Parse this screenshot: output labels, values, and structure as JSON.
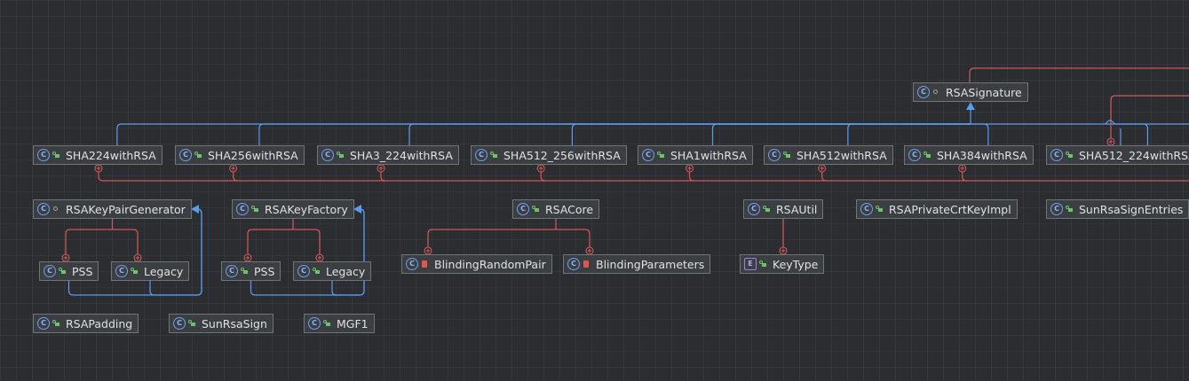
{
  "colors": {
    "background": "#2b2d30",
    "node_fill": "#3c3f41",
    "node_border": "#6f737a",
    "inheritance_edge": "#5b9bf0",
    "inner_class_edge": "#d05a5a",
    "class_icon": "#6e9ef7",
    "public_icon": "#6cc46a",
    "private_icon": "#e0564f"
  },
  "nodes": [
    {
      "id": "RSASignature",
      "label": "RSASignature",
      "kind": "class",
      "access": "package",
      "icon": "class-icon"
    },
    {
      "id": "SHA224withRSA",
      "label": "SHA224withRSA",
      "kind": "class",
      "access": "public",
      "icon": "class-icon"
    },
    {
      "id": "SHA256withRSA",
      "label": "SHA256withRSA",
      "kind": "class",
      "access": "public",
      "icon": "class-icon"
    },
    {
      "id": "SHA3_224withRSA",
      "label": "SHA3_224withRSA",
      "kind": "class",
      "access": "public",
      "icon": "class-icon"
    },
    {
      "id": "SHA512_256withRSA",
      "label": "SHA512_256withRSA",
      "kind": "class",
      "access": "public",
      "icon": "class-icon"
    },
    {
      "id": "SHA1withRSA",
      "label": "SHA1withRSA",
      "kind": "class",
      "access": "public",
      "icon": "class-icon"
    },
    {
      "id": "SHA512withRSA",
      "label": "SHA512withRSA",
      "kind": "class",
      "access": "public",
      "icon": "class-icon"
    },
    {
      "id": "SHA384withRSA",
      "label": "SHA384withRSA",
      "kind": "class",
      "access": "public",
      "icon": "class-icon"
    },
    {
      "id": "SHA512_224withRSA",
      "label": "SHA512_224withRSA",
      "kind": "class",
      "access": "public",
      "icon": "class-icon"
    },
    {
      "id": "RSAKeyPairGenerator",
      "label": "RSAKeyPairGenerator",
      "kind": "class",
      "access": "package",
      "icon": "class-icon"
    },
    {
      "id": "RSAKeyFactory",
      "label": "RSAKeyFactory",
      "kind": "class",
      "access": "public",
      "icon": "class-icon"
    },
    {
      "id": "RSACore",
      "label": "RSACore",
      "kind": "class",
      "access": "public",
      "icon": "class-icon"
    },
    {
      "id": "RSAUtil",
      "label": "RSAUtil",
      "kind": "class",
      "access": "public",
      "icon": "class-icon"
    },
    {
      "id": "RSAPrivateCrtKeyImpl",
      "label": "RSAPrivateCrtKeyImpl",
      "kind": "class",
      "access": "public",
      "icon": "class-icon"
    },
    {
      "id": "SunRsaSignEntries",
      "label": "SunRsaSignEntries",
      "kind": "class",
      "access": "public",
      "icon": "class-icon"
    },
    {
      "id": "KPG_PSS",
      "label": "PSS",
      "kind": "class",
      "access": "public",
      "icon": "class-icon"
    },
    {
      "id": "KPG_Legacy",
      "label": "Legacy",
      "kind": "class",
      "access": "public",
      "icon": "class-icon"
    },
    {
      "id": "KF_PSS",
      "label": "PSS",
      "kind": "class",
      "access": "public",
      "icon": "class-icon"
    },
    {
      "id": "KF_Legacy",
      "label": "Legacy",
      "kind": "class",
      "access": "public",
      "icon": "class-icon"
    },
    {
      "id": "BlindingRandomPair",
      "label": "BlindingRandomPair",
      "kind": "class",
      "access": "private",
      "icon": "class-icon"
    },
    {
      "id": "BlindingParameters",
      "label": "BlindingParameters",
      "kind": "class",
      "access": "private",
      "icon": "class-icon"
    },
    {
      "id": "KeyType",
      "label": "KeyType",
      "kind": "enum",
      "access": "public",
      "icon": "enum-icon"
    },
    {
      "id": "RSAPadding",
      "label": "RSAPadding",
      "kind": "class",
      "access": "public",
      "icon": "class-icon"
    },
    {
      "id": "SunRsaSign",
      "label": "SunRsaSign",
      "kind": "class",
      "access": "public",
      "icon": "class-icon"
    },
    {
      "id": "MGF1",
      "label": "MGF1",
      "kind": "class",
      "access": "public",
      "icon": "class-icon"
    }
  ],
  "edges": [
    {
      "from": "SHA224withRSA",
      "to": "RSASignature",
      "type": "extends"
    },
    {
      "from": "SHA256withRSA",
      "to": "RSASignature",
      "type": "extends"
    },
    {
      "from": "SHA3_224withRSA",
      "to": "RSASignature",
      "type": "extends"
    },
    {
      "from": "SHA512_256withRSA",
      "to": "RSASignature",
      "type": "extends"
    },
    {
      "from": "SHA1withRSA",
      "to": "RSASignature",
      "type": "extends"
    },
    {
      "from": "SHA512withRSA",
      "to": "RSASignature",
      "type": "extends"
    },
    {
      "from": "SHA384withRSA",
      "to": "RSASignature",
      "type": "extends"
    },
    {
      "from": "SHA512_224withRSA",
      "to": "RSASignature",
      "type": "extends"
    },
    {
      "from": "KPG_PSS",
      "to": "RSAKeyPairGenerator",
      "type": "extends"
    },
    {
      "from": "KPG_Legacy",
      "to": "RSAKeyPairGenerator",
      "type": "extends"
    },
    {
      "from": "KF_PSS",
      "to": "RSAKeyFactory",
      "type": "extends"
    },
    {
      "from": "KF_Legacy",
      "to": "RSAKeyFactory",
      "type": "extends"
    },
    {
      "from": "RSAKeyPairGenerator",
      "to": "KPG_PSS",
      "type": "inner"
    },
    {
      "from": "RSAKeyPairGenerator",
      "to": "KPG_Legacy",
      "type": "inner"
    },
    {
      "from": "RSAKeyFactory",
      "to": "KF_PSS",
      "type": "inner"
    },
    {
      "from": "RSAKeyFactory",
      "to": "KF_Legacy",
      "type": "inner"
    },
    {
      "from": "RSACore",
      "to": "BlindingRandomPair",
      "type": "inner"
    },
    {
      "from": "RSACore",
      "to": "BlindingParameters",
      "type": "inner"
    },
    {
      "from": "RSAUtil",
      "to": "KeyType",
      "type": "inner"
    },
    {
      "from": "SHA224withRSA",
      "to": "RSASignature",
      "type": "inner"
    },
    {
      "from": "SHA256withRSA",
      "to": "RSASignature",
      "type": "inner"
    },
    {
      "from": "SHA3_224withRSA",
      "to": "RSASignature",
      "type": "inner"
    },
    {
      "from": "SHA512_256withRSA",
      "to": "RSASignature",
      "type": "inner"
    },
    {
      "from": "SHA1withRSA",
      "to": "RSASignature",
      "type": "inner"
    },
    {
      "from": "SHA512withRSA",
      "to": "RSASignature",
      "type": "inner"
    },
    {
      "from": "SHA384withRSA",
      "to": "RSASignature",
      "type": "inner"
    },
    {
      "from": "SHA512_224withRSA",
      "to": "RSASignature",
      "type": "inner"
    }
  ]
}
